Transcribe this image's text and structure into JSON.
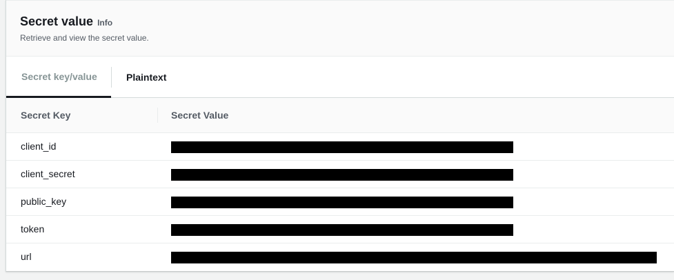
{
  "header": {
    "title": "Secret value",
    "info_link": "Info",
    "subtitle": "Retrieve and view the secret value."
  },
  "tabs": [
    {
      "label": "Secret key/value",
      "active": true
    },
    {
      "label": "Plaintext",
      "active": false
    }
  ],
  "table": {
    "columns": [
      "Secret Key",
      "Secret Value"
    ],
    "rows": [
      {
        "key": "client_id",
        "value_redacted": true
      },
      {
        "key": "client_secret",
        "value_redacted": true
      },
      {
        "key": "public_key",
        "value_redacted": true
      },
      {
        "key": "token",
        "value_redacted": true
      },
      {
        "key": "url",
        "value_redacted": true
      }
    ]
  },
  "colors": {
    "text": "#16191f",
    "muted": "#545b64",
    "redaction": "#000000"
  }
}
